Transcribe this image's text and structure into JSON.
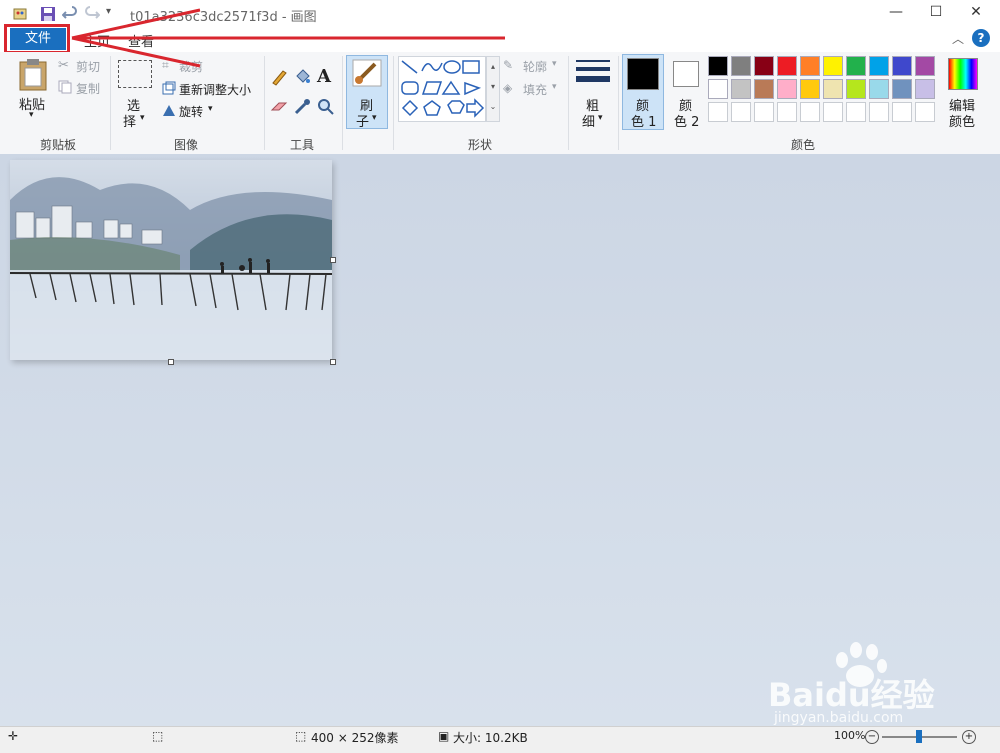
{
  "window": {
    "title": "t01a3236c3dc2571f3d - 画图",
    "controls": {
      "minimize": "—",
      "maximize": "☐",
      "close": "✕"
    }
  },
  "tabs": {
    "file": "文件",
    "home": "主页",
    "view": "查看"
  },
  "ribbon": {
    "clipboard": {
      "paste": "粘贴",
      "cut": "剪切",
      "copy": "复制",
      "group": "剪贴板"
    },
    "image": {
      "select_top": "选",
      "select_bottom": "择",
      "crop": "裁剪",
      "resize": "重新调整大小",
      "rotate": "旋转",
      "group": "图像"
    },
    "tools": {
      "group": "工具",
      "text_glyph": "A"
    },
    "brushes": {
      "top": "刷",
      "bottom": "子"
    },
    "shapes": {
      "outline": "轮廓",
      "fill": "填充",
      "group": "形状"
    },
    "size": {
      "top": "粗",
      "bottom": "细"
    },
    "colors": {
      "color1_top": "颜",
      "color1_bottom": "色 1",
      "color2_top": "颜",
      "color2_bottom": "色 2",
      "edit_top": "编辑",
      "edit_bottom": "颜色",
      "group": "颜色",
      "palette_row1": [
        "#000000",
        "#7f7f7f",
        "#880015",
        "#ed1c24",
        "#ff7f27",
        "#fff200",
        "#22b14c",
        "#00a2e8",
        "#3f48cc",
        "#a349a4"
      ],
      "palette_row2": [
        "#ffffff",
        "#c3c3c3",
        "#b97a57",
        "#ffaec9",
        "#ffc90e",
        "#efe4b0",
        "#b5e61d",
        "#99d9ea",
        "#7092be",
        "#c8bfe7"
      ]
    }
  },
  "status": {
    "dimensions": "400 × 252像素",
    "size": "大小: 10.2KB",
    "zoom": "100%"
  },
  "watermark": {
    "brand": "Baidu经验",
    "url": "jingyan.baidu.com"
  }
}
